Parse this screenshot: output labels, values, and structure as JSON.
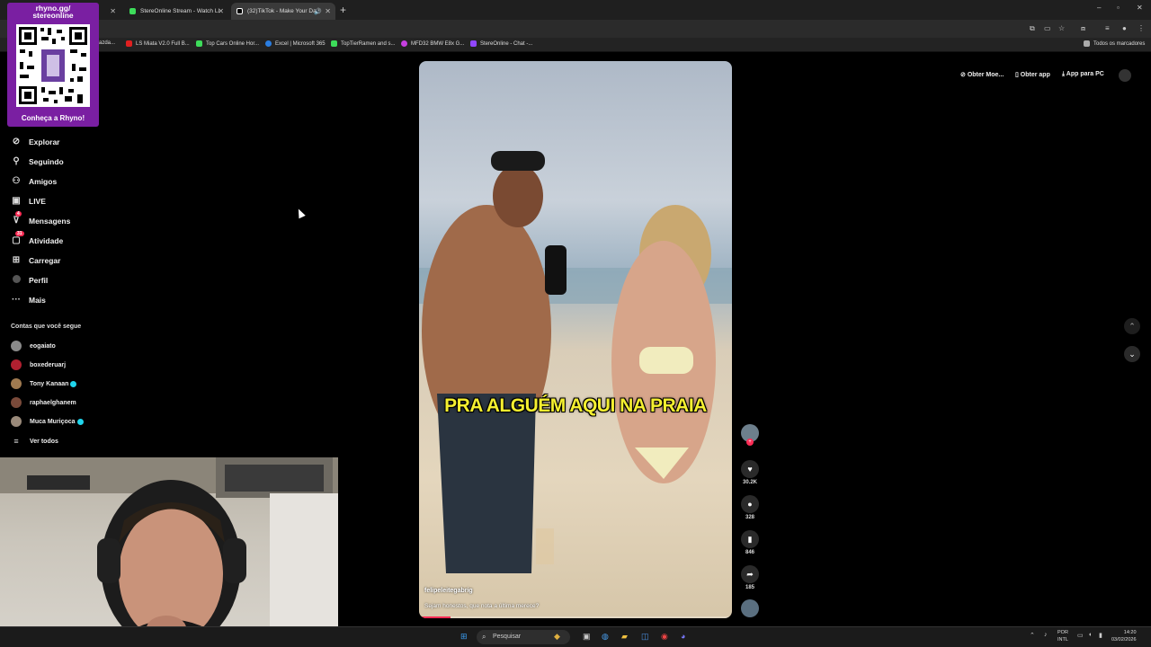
{
  "browser": {
    "tabs": [
      {
        "label": "StereOnline Stream - Watch Li"
      },
      {
        "label": "(32)TikTok - Make Your Day"
      }
    ],
    "bookmarks": [
      {
        "label": "azda..."
      },
      {
        "label": "LS Miata V2.0 Full B..."
      },
      {
        "label": "Top Cars Online Hor..."
      },
      {
        "label": "Excel | Microsoft 365"
      },
      {
        "label": "TopTierRamen and s..."
      },
      {
        "label": "MFD32 BMW E8x G..."
      },
      {
        "label": "StereOnline - Chat -..."
      }
    ],
    "all_bookmarks": "Todos os marcadores"
  },
  "overlay": {
    "title_line1": "rhyno.gg/",
    "title_line2": "stereonline",
    "caption": "Conheça a Rhyno!"
  },
  "nav": {
    "items": [
      {
        "label": "Explorar",
        "icon": "compass-icon"
      },
      {
        "label": "Seguindo",
        "icon": "person-icon"
      },
      {
        "label": "Amigos",
        "icon": "friends-icon"
      },
      {
        "label": "LIVE",
        "icon": "live-icon"
      },
      {
        "label": "Mensagens",
        "icon": "message-icon",
        "badge": "4"
      },
      {
        "label": "Atividade",
        "icon": "activity-icon",
        "badge": "31"
      },
      {
        "label": "Carregar",
        "icon": "upload-icon"
      },
      {
        "label": "Perfil",
        "icon": "avatar-icon"
      },
      {
        "label": "Mais",
        "icon": "more-icon"
      }
    ],
    "following_heading": "Contas que você segue",
    "following": [
      {
        "name": "eogaiato",
        "verified": false
      },
      {
        "name": "boxederuarj",
        "verified": false
      },
      {
        "name": "Tony Kanaan",
        "verified": true
      },
      {
        "name": "raphaelghanem",
        "verified": false
      },
      {
        "name": "Muca Muriçoca",
        "verified": true
      }
    ],
    "see_all": "Ver todos"
  },
  "top_right": {
    "get_coins": "Obter Moe...",
    "get_app": "Obter app",
    "pc_app": "App para PC"
  },
  "video": {
    "caption": "PRA ALGUÉM AQUI NA PRAIA",
    "author": "felipeleitegabrig",
    "description": "Sejam honestos, que nota a última merece?",
    "progress": 0.1
  },
  "actions": {
    "likes": "30.2K",
    "comments": "328",
    "saves": "846",
    "shares": "185"
  },
  "taskbar": {
    "search_placeholder": "Pesquisar",
    "lang_line1": "POR",
    "lang_line2": "INTL",
    "time": "14:20",
    "date": "03/02/2026"
  },
  "colors": {
    "accent": "#fe2c55",
    "overlay": "#7a1fa2",
    "caption": "#f4ef30",
    "verified": "#20d5ec"
  }
}
